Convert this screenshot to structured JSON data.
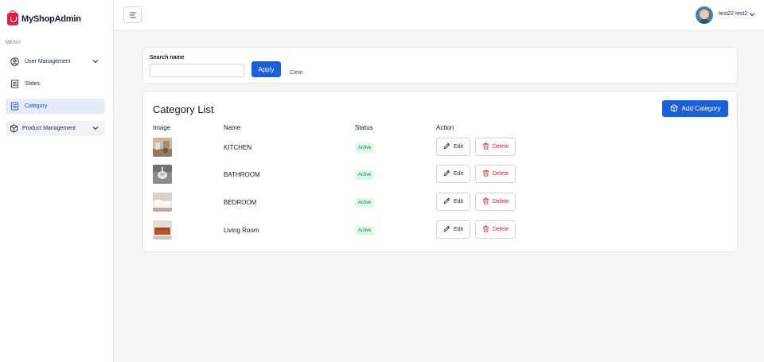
{
  "app": {
    "brand": "MyShopAdmin",
    "brand_color": "#e11d48",
    "accent_color": "#1d5fd6"
  },
  "sidebar": {
    "menu_label": "MENU",
    "items": [
      {
        "label": "User Management",
        "icon": "user-circle-icon",
        "has_chevron": true,
        "active": false
      },
      {
        "label": "Slides",
        "icon": "document-list-icon",
        "has_chevron": false,
        "active": false
      },
      {
        "label": "Category",
        "icon": "document-list-icon",
        "has_chevron": false,
        "active": true
      },
      {
        "label": "Product Management",
        "icon": "box-icon",
        "has_chevron": true,
        "active": false
      }
    ]
  },
  "topbar": {
    "menu_icon": "hamburger-icon",
    "user_name": "test22 test2",
    "avatar_icon": "avatar-icon"
  },
  "filter": {
    "label": "Search name",
    "value": "",
    "placeholder": "",
    "apply_label": "Apply",
    "clear_label": "Clear"
  },
  "category_list": {
    "title": "Category List",
    "add_label": "Add Category",
    "columns": [
      "Image",
      "Name",
      "Status",
      "Action"
    ],
    "rows": [
      {
        "name": "KITCHEN",
        "status": "Active",
        "edit_label": "Edit",
        "delete_label": "Delete"
      },
      {
        "name": "BATHROOM",
        "status": "Active",
        "edit_label": "Edit",
        "delete_label": "Delete"
      },
      {
        "name": "BEDROOM",
        "status": "Active",
        "edit_label": "Edit",
        "delete_label": "Delete"
      },
      {
        "name": "Living Room",
        "status": "Active",
        "edit_label": "Edit",
        "delete_label": "Delete"
      }
    ],
    "status_colors": {
      "bg": "#dcfce7",
      "text": "#15803d"
    },
    "delete_color": "#dc2626"
  }
}
